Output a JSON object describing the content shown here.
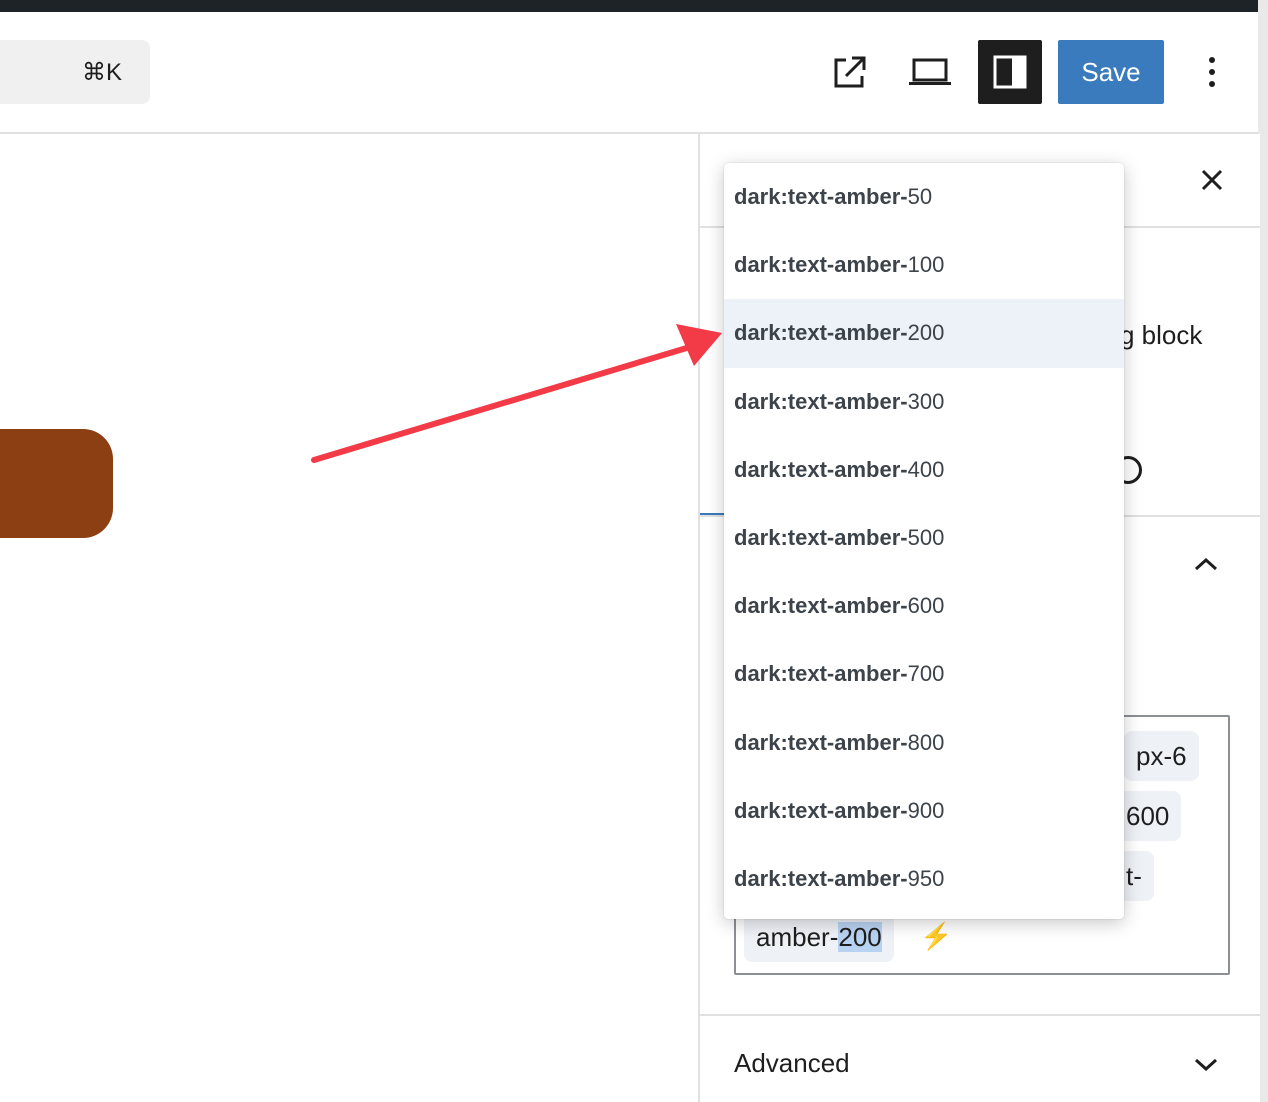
{
  "header": {
    "command_shortcut": "⌘K",
    "save_label": "Save"
  },
  "sidebar": {
    "partial_text": "g block",
    "classes": {
      "chip_px6": "px-6",
      "chip_600": "600",
      "chip_t": "t-",
      "chip_amber_prefix": "amber-",
      "chip_amber_highlight": "200",
      "bolt": "⚡"
    },
    "advanced_label": "Advanced"
  },
  "dropdown": {
    "options": [
      {
        "prefix": "dark:text-amber-",
        "suffix": "50"
      },
      {
        "prefix": "dark:text-amber-",
        "suffix": "100"
      },
      {
        "prefix": "dark:text-amber-",
        "suffix": "200"
      },
      {
        "prefix": "dark:text-amber-",
        "suffix": "300"
      },
      {
        "prefix": "dark:text-amber-",
        "suffix": "400"
      },
      {
        "prefix": "dark:text-amber-",
        "suffix": "500"
      },
      {
        "prefix": "dark:text-amber-",
        "suffix": "600"
      },
      {
        "prefix": "dark:text-amber-",
        "suffix": "700"
      },
      {
        "prefix": "dark:text-amber-",
        "suffix": "800"
      },
      {
        "prefix": "dark:text-amber-",
        "suffix": "900"
      },
      {
        "prefix": "dark:text-amber-",
        "suffix": "950"
      }
    ],
    "active_index": 2
  },
  "colors": {
    "accent": "#3a7bbd",
    "button_brown": "#8b3f12",
    "annotation_arrow": "#f23b47",
    "highlight": "#edf2f9"
  },
  "icons": [
    "external-link-icon",
    "laptop-icon",
    "sidebar-toggle-icon",
    "more-vertical-icon",
    "close-icon",
    "chevron-up-icon",
    "chevron-down-icon",
    "lightning-icon"
  ]
}
